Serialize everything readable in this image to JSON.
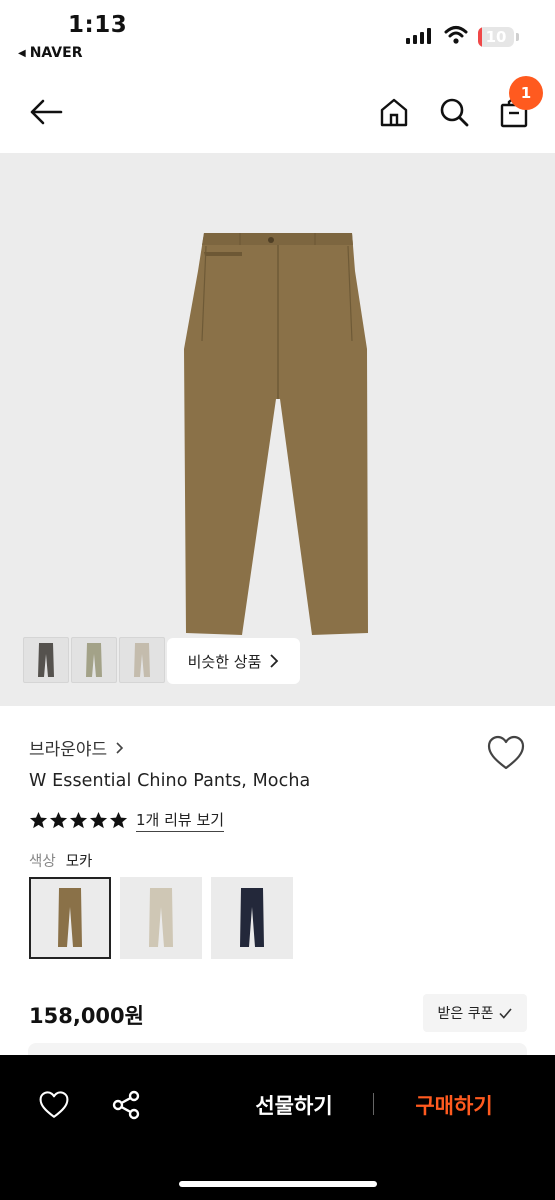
{
  "status_bar": {
    "time": "1:13",
    "back_app": "NAVER",
    "battery": "10",
    "battery_level": 0.1
  },
  "header": {
    "back_icon": "arrow-left-icon",
    "home_icon": "home-icon",
    "search_icon": "search-icon",
    "cart_icon": "shopping-bag-icon",
    "cart_badge": "1"
  },
  "gallery": {
    "thumbnails": [
      "charcoal",
      "khaki",
      "beige"
    ],
    "similar_label": "비슷한 상품"
  },
  "product": {
    "brand": "브라운야드",
    "name": "W Essential Chino Pants, Mocha",
    "rating": 5,
    "review_link": "1개 리뷰 보기",
    "color_label": "색상",
    "color_value": "모카",
    "swatches": [
      "mocha",
      "beige",
      "navy"
    ],
    "price": "158,000원",
    "coupon_label": "받은 쿠폰"
  },
  "bottom_bar": {
    "gift_label": "선물하기",
    "buy_label": "구매하기"
  },
  "colors": {
    "accent": "#ff5a1f",
    "mocha": "#8a7148",
    "hero_bg": "#ececec",
    "bottom_bar": "#000000"
  }
}
